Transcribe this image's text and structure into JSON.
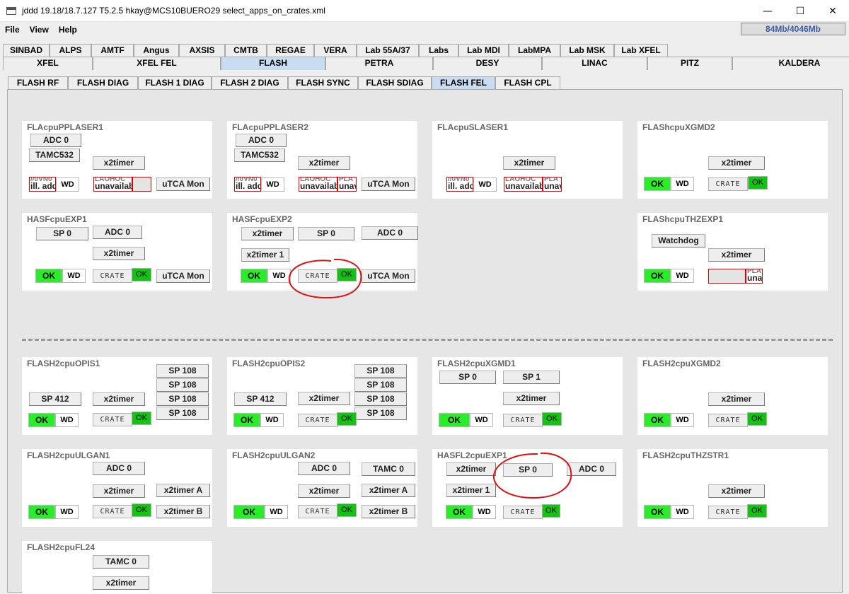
{
  "window": {
    "title": "jddd 19.18/18.7.127 T5.2.5  hkay@MCS10BUERO29  select_apps_on_crates.xml",
    "controls": {
      "minimize": "—",
      "maximize": "☐",
      "close": "✕"
    }
  },
  "menubar": {
    "items": [
      "File",
      "View",
      "Help"
    ],
    "memory": "84Mb/4046Mb"
  },
  "tabs": {
    "row1": [
      "SINBAD",
      "ALPS",
      "AMTF",
      "Angus",
      "AXSIS",
      "CMTB",
      "REGAE",
      "VERA",
      "Lab 55A/37",
      "Labs",
      "Lab MDI",
      "LabMPA",
      "Lab MSK",
      "Lab XFEL"
    ],
    "row2": [
      "XFEL",
      "XFEL FEL",
      "FLASH",
      "PETRA",
      "DESY",
      "LINAC",
      "PITZ",
      "KALDERA"
    ],
    "row2_active": "FLASH",
    "row3": [
      "FLASH  RF",
      "FLASH  DIAG",
      "FLASH 1 DIAG",
      "FLASH 2 DIAG",
      "FLASH SYNC",
      "FLASH  SDIAG",
      "FLASH  FEL",
      "FLASH  CPL"
    ],
    "row3_active": "FLASH  FEL"
  },
  "labels": {
    "ok": "OK",
    "wd": "WD",
    "crate": "CRATE",
    "adc0": "ADC 0",
    "tamc532": "TAMC532",
    "x2timer": "x2timer",
    "utca": "uTCA Mon",
    "sp0": "SP 0",
    "sp1": "SP 1",
    "sp412": "SP 412",
    "sp108": "SP 108",
    "x2timer1": "x2timer 1",
    "x2timerA": "x2timer A",
    "x2timerB": "x2timer B",
    "watchdog": "Watchdog",
    "tamc0": "TAMC 0",
    "ill_add": "ill. add",
    "ill_ghost": "//0VN0",
    "unavail": "unavailab",
    "unavail_ghost": "LAOHOC",
    "unav": "unav",
    "unav_ghost": "PLA"
  },
  "panels": {
    "p1": "FLAcpuPPLASER1",
    "p2": "FLAcpuPPLASER2",
    "p3": "FLAcpuSLASER1",
    "p4": "FLAShcpuXGMD2",
    "p5": "HASFcpuEXP1",
    "p6": "HASFcpuEXP2",
    "p8": "FLAShcpuTHZEXP1",
    "p9": "FLASH2cpuOPIS1",
    "p10": "FLASH2cpuOPIS2",
    "p11": "FLASH2cpuXGMD1",
    "p12": "FLASH2cpuXGMD2",
    "p13": "FLASH2cpuULGAN1",
    "p14": "FLASH2cpuULGAN2",
    "p15": "HASFL2cpuEXP1",
    "p16": "FLASH2cpuTHZSTR1",
    "p17": "FLASH2cpuFL24"
  }
}
